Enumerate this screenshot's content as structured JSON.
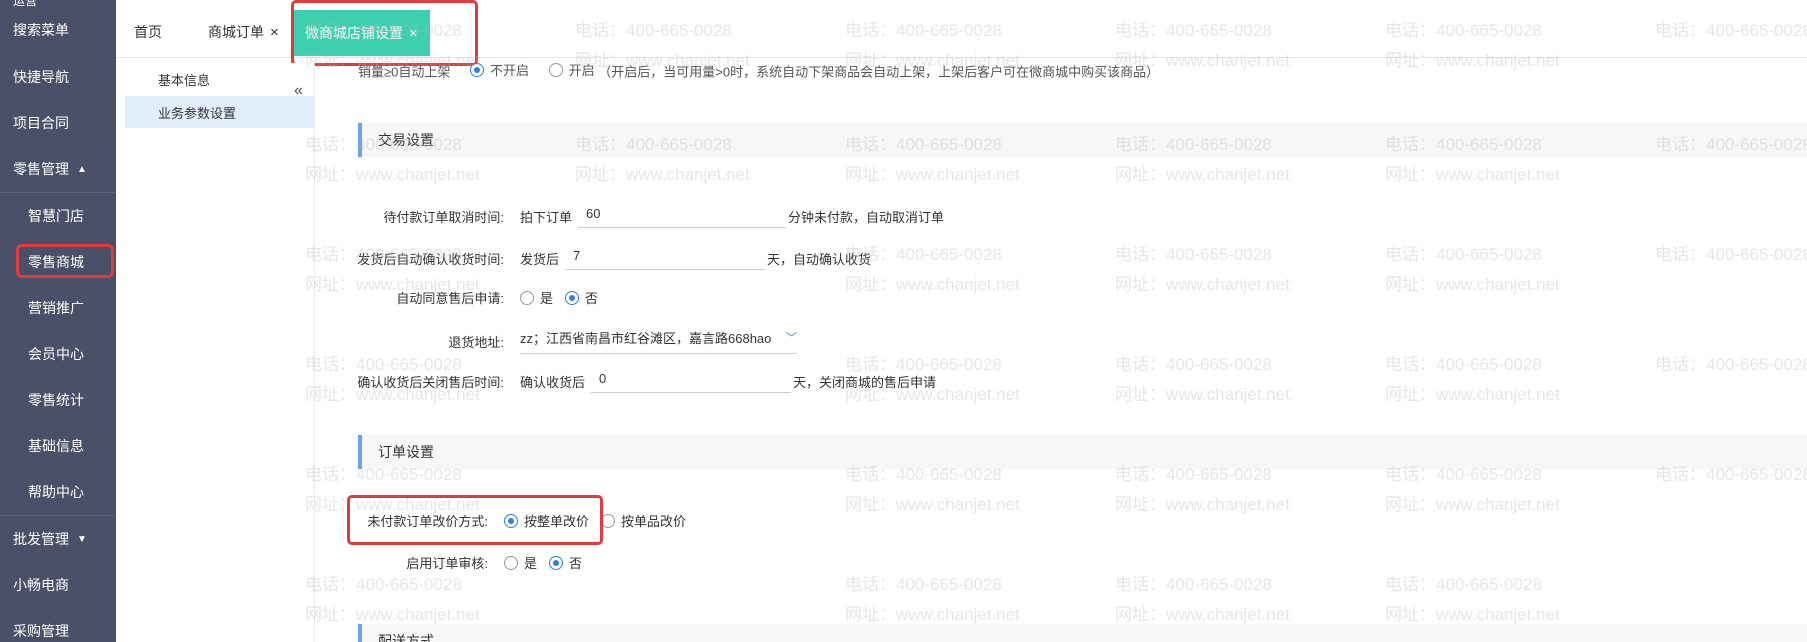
{
  "nav": {
    "top_label": "运营",
    "items": [
      {
        "label": "搜索菜单",
        "caret": ""
      },
      {
        "label": "快捷导航",
        "caret": ""
      },
      {
        "label": "项目合同",
        "caret": ""
      },
      {
        "label": "零售管理",
        "caret": "▲"
      },
      {
        "label": "智慧门店",
        "caret": ""
      },
      {
        "label": "零售商城",
        "caret": ""
      },
      {
        "label": "营销推广",
        "caret": ""
      },
      {
        "label": "会员中心",
        "caret": ""
      },
      {
        "label": "零售统计",
        "caret": ""
      },
      {
        "label": "基础信息",
        "caret": ""
      },
      {
        "label": "帮助中心",
        "caret": ""
      },
      {
        "label": "批发管理",
        "caret": "▼"
      },
      {
        "label": "小畅电商",
        "caret": ""
      },
      {
        "label": "采购管理",
        "caret": ""
      }
    ]
  },
  "tabs": [
    {
      "label": "首页",
      "close": ""
    },
    {
      "label": "商城订单",
      "close": "×"
    },
    {
      "label": "微商城店铺设置",
      "close": "×"
    }
  ],
  "submenu": [
    {
      "label": "基本信息"
    },
    {
      "label": "业务参数设置"
    }
  ],
  "collapse_icon": "«",
  "top_row": {
    "label": "销量≥0自动上架",
    "opt_off": "不开启",
    "opt_on": "开启",
    "note": "（开启后，当可用量>0时，系统自动下架商品会自动上架，上架后客户可在微商城中购买该商品）"
  },
  "sections": {
    "trade": "交易设置",
    "order": "订单设置",
    "delivery": "配送方式"
  },
  "trade": {
    "cancel": {
      "label": "待付款订单取消时间:",
      "pre": "拍下订单",
      "value": "60",
      "post": "分钟未付款，自动取消订单"
    },
    "confirm": {
      "label": "发货后自动确认收货时间:",
      "pre": "发货后",
      "value": "7",
      "post": "天，自动确认收货"
    },
    "aftersale": {
      "label": "自动同意售后申请:",
      "yes": "是",
      "no": "否"
    },
    "address": {
      "label": "退货地址:",
      "value": "zz；江西省南昌市红谷滩区，嘉言路668hao"
    },
    "close_aftersale": {
      "label": "确认收货后关闭售后时间:",
      "pre": "确认收货后",
      "value": "0",
      "post": "天，关闭商城的售后申请"
    }
  },
  "order": {
    "price_mode": {
      "label": "未付款订单改价方式:",
      "opt1": "按整单改价",
      "opt2": "按单品改价"
    },
    "audit": {
      "label": "启用订单审核:",
      "yes": "是",
      "no": "否"
    }
  },
  "watermark": {
    "phone": "电话：400-665-0028",
    "site": "网址：www.chanjet.net"
  }
}
